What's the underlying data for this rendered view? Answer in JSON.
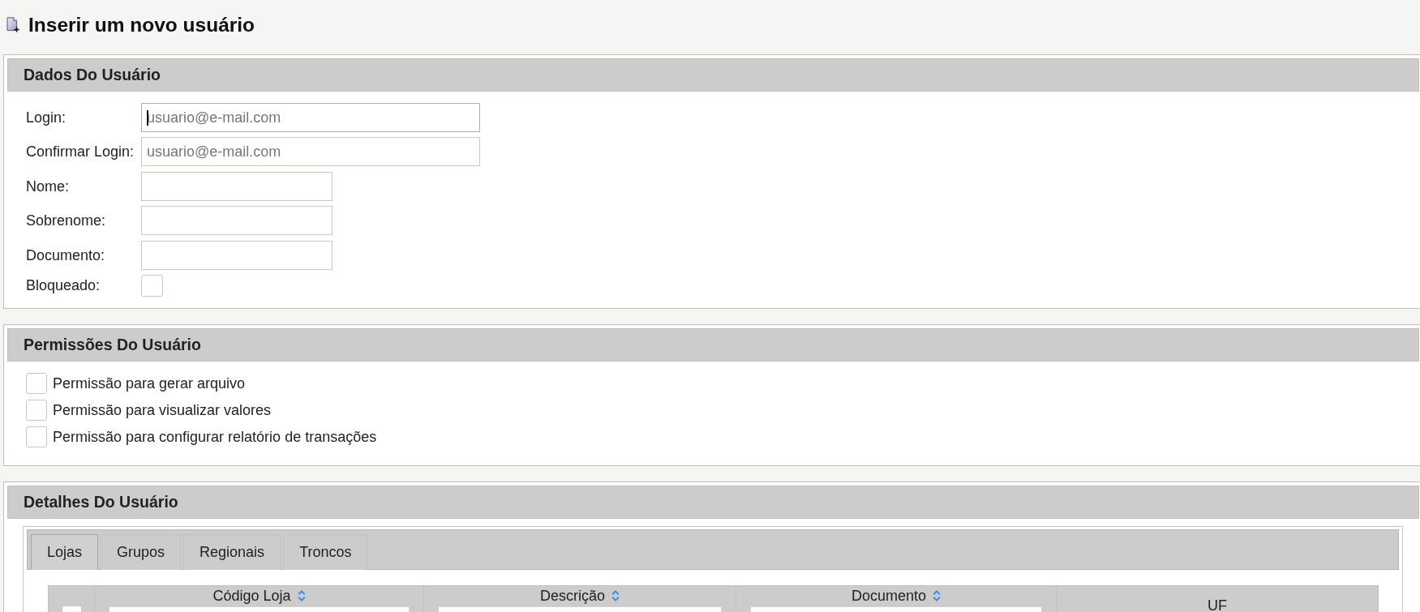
{
  "page": {
    "title": "Inserir um novo usuário"
  },
  "user_data": {
    "title": "Dados Do Usuário",
    "fields": [
      {
        "label": "Login:",
        "kind": "email",
        "placeholder": "usuario@e-mail.com",
        "focused": true
      },
      {
        "label": "Confirmar Login:",
        "kind": "email",
        "placeholder": "usuario@e-mail.com",
        "focused": false
      },
      {
        "label": "Nome:",
        "kind": "text",
        "focused": false
      },
      {
        "label": "Sobrenome:",
        "kind": "text",
        "focused": false
      },
      {
        "label": "Documento:",
        "kind": "text",
        "focused": false
      },
      {
        "label": "Bloqueado:",
        "kind": "checkbox",
        "checked": false
      }
    ]
  },
  "permissions": {
    "title": "Permissões Do Usuário",
    "items": [
      {
        "label": "Permissão para gerar arquivo",
        "checked": false
      },
      {
        "label": "Permissão para visualizar valores",
        "checked": false
      },
      {
        "label": "Permissão para configurar relatório de transações",
        "checked": false
      }
    ]
  },
  "details": {
    "title": "Detalhes Do Usuário",
    "tabs": [
      {
        "label": "Lojas",
        "selected": true
      },
      {
        "label": "Grupos",
        "selected": false
      },
      {
        "label": "Regionais",
        "selected": false
      },
      {
        "label": "Troncos",
        "selected": false
      }
    ],
    "table": {
      "select_all": {
        "checked": false
      },
      "columns": [
        {
          "label": "Código Loja",
          "sortable": true,
          "filter": true
        },
        {
          "label": "Descrição",
          "sortable": true,
          "filter": true
        },
        {
          "label": "Documento",
          "sortable": true,
          "filter": true
        },
        {
          "label": "UF",
          "sortable": false,
          "filter": false
        }
      ]
    }
  }
}
